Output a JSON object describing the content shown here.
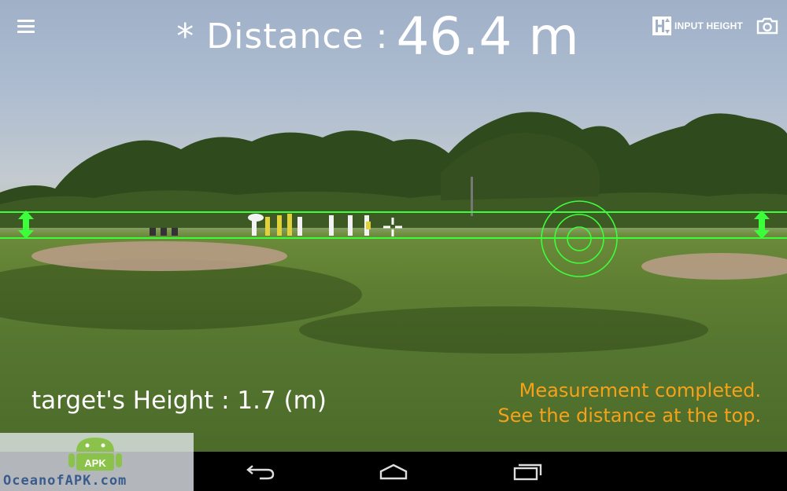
{
  "header": {
    "distance_label": "* Distance :",
    "distance_value": "46.4 m",
    "input_height_label": "INPUT HEIGHT"
  },
  "icons": {
    "menu": "hamburger-menu-icon",
    "input_height": "height-ruler-icon",
    "camera": "camera-icon",
    "crosshair": "crosshair-icon",
    "target": "target-reticle-icon",
    "height_arrow": "double-arrow-icon",
    "back": "back-icon",
    "home": "home-icon",
    "recents": "recent-apps-icon"
  },
  "measurement": {
    "target_height": "target's Height : 1.7 (m)",
    "status_line1": "Measurement completed.",
    "status_line2": "See the distance at the top."
  },
  "watermark": {
    "badge": "APK",
    "text": "OceanofAPK.com"
  },
  "colors": {
    "hud_green": "#3cff3c",
    "status_orange": "#f5a21a",
    "watermark_blue": "#3a5c8c"
  }
}
